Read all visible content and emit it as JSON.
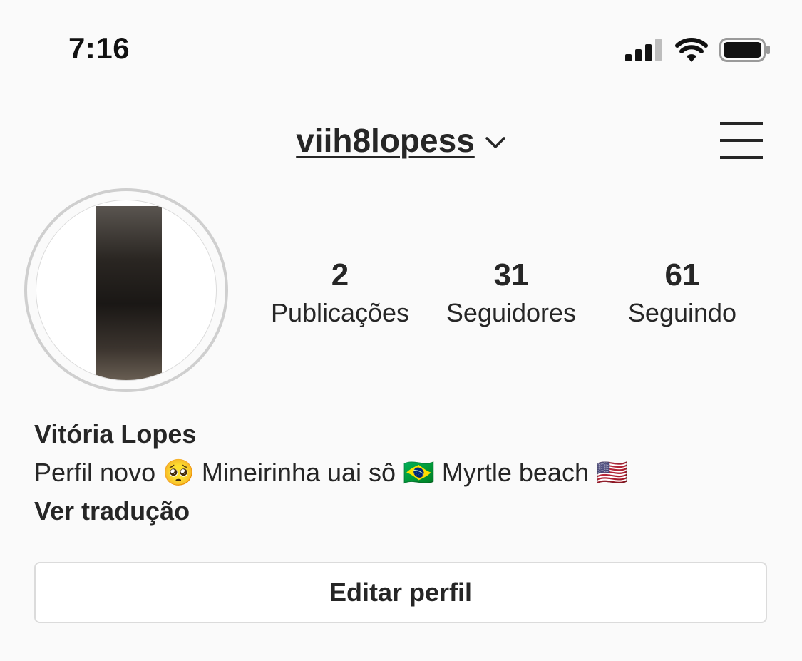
{
  "status_bar": {
    "time": "7:16"
  },
  "header": {
    "username": "viih8lopess"
  },
  "stats": {
    "posts_count": "2",
    "posts_label": "Publicações",
    "followers_count": "31",
    "followers_label": "Seguidores",
    "following_count": "61",
    "following_label": "Seguindo"
  },
  "profile": {
    "full_name": "Vitória Lopes",
    "bio": "Perfil novo 🥺 Mineirinha uai sô 🇧🇷 Myrtle beach 🇺🇸",
    "translate_label": "Ver tradução"
  },
  "actions": {
    "edit_profile_label": "Editar perfil"
  },
  "icons": {
    "signal": "signal-icon",
    "wifi": "wifi-icon",
    "battery": "battery-icon",
    "chevron": "chevron-down-icon",
    "menu": "menu-icon"
  },
  "colors": {
    "background": "#fafafa",
    "text": "#262626",
    "border": "#dbdbdb"
  }
}
